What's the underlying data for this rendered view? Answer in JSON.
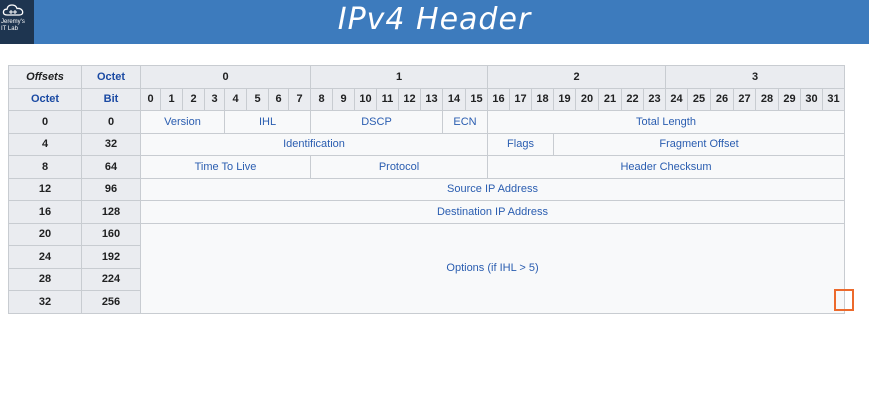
{
  "banner": {
    "title": "IPv4 Header",
    "logo_text": [
      "Jeremy's",
      "IT Lab"
    ]
  },
  "headers": {
    "offsets": "Offsets",
    "octet": "Octet",
    "octet_row": "Octet",
    "bit_row": "Bit",
    "octet_numbers": [
      "0",
      "1",
      "2",
      "3"
    ],
    "bits": [
      "0",
      "1",
      "2",
      "3",
      "4",
      "5",
      "6",
      "7",
      "8",
      "9",
      "10",
      "11",
      "12",
      "13",
      "14",
      "15",
      "16",
      "17",
      "18",
      "19",
      "20",
      "21",
      "22",
      "23",
      "24",
      "25",
      "26",
      "27",
      "28",
      "29",
      "30",
      "31"
    ]
  },
  "rows": [
    {
      "octet": "0",
      "bit": "0",
      "fields": [
        "Version",
        "IHL",
        "DSCP",
        "ECN",
        "Total Length"
      ]
    },
    {
      "octet": "4",
      "bit": "32",
      "fields": [
        "Identification",
        "Flags",
        "Fragment Offset"
      ]
    },
    {
      "octet": "8",
      "bit": "64",
      "fields": [
        "Time To Live",
        "Protocol",
        "Header Checksum"
      ]
    },
    {
      "octet": "12",
      "bit": "96",
      "fields": [
        "Source IP Address"
      ]
    },
    {
      "octet": "16",
      "bit": "128",
      "fields": [
        "Destination IP Address"
      ]
    },
    {
      "octet": "20",
      "bit": "160",
      "fields": [
        "Options (if IHL > 5)"
      ]
    },
    {
      "octet": "24",
      "bit": "192"
    },
    {
      "octet": "28",
      "bit": "224"
    },
    {
      "octet": "32",
      "bit": "256"
    }
  ],
  "colors": {
    "banner": "#3d7bbd",
    "header_bg": "#eaecf0",
    "field_text": "#2a5db0",
    "highlight": "#ec6a2c"
  }
}
